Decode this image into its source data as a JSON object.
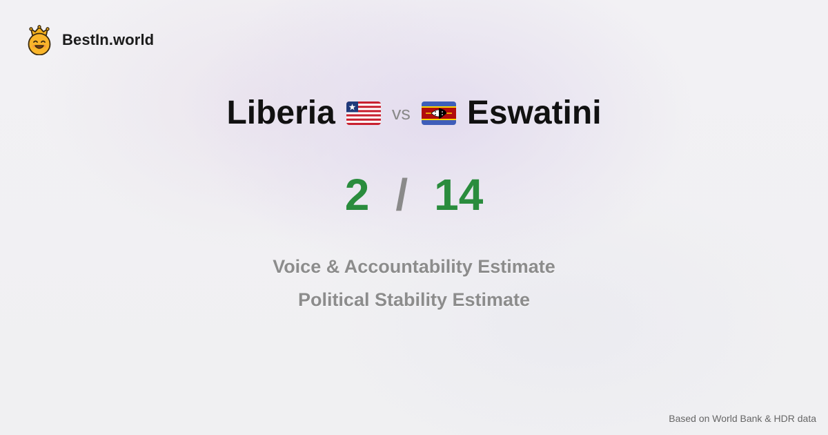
{
  "brand": {
    "name": "BestIn.world",
    "logo_icon": "crowned-smiley-icon"
  },
  "comparison": {
    "left_country": "Liberia",
    "left_flag_icon": "liberia-flag-icon",
    "vs_label": "vs",
    "right_country": "Eswatini",
    "right_flag_icon": "eswatini-flag-icon"
  },
  "score": {
    "left": "2",
    "separator": "/",
    "right": "14"
  },
  "metrics": [
    "Voice & Accountability Estimate",
    "Political Stability Estimate"
  ],
  "footer": {
    "source_text": "Based on World Bank & HDR data"
  },
  "colors": {
    "score_green": "#2a8c3d",
    "muted_gray": "#8a8a8a"
  }
}
